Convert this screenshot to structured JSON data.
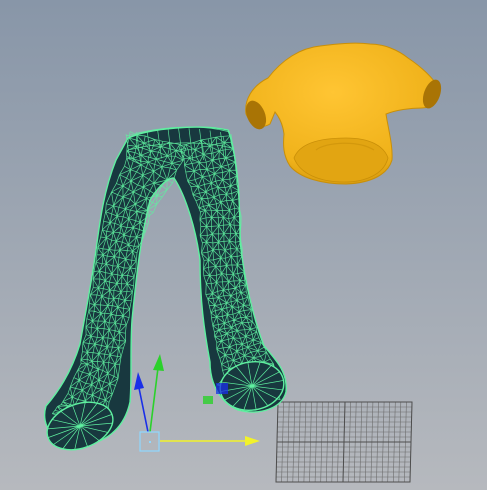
{
  "viewport": {
    "background_top": "#8896a8",
    "background_bottom": "#b6b9be",
    "wireframe_color": "#5ff0a0",
    "wireframe_fill": "#18383f",
    "shirt_color": "#f0b21a",
    "shirt_shadow": "#b98206",
    "grid_color": "#6c6c6c",
    "manipulator": {
      "x_axis_color": "#f2f22a",
      "y_axis_color": "#2bd12b",
      "z_axis_color": "#1a2fe8",
      "center_color": "#8fd8ff"
    }
  },
  "objects": {
    "pants": "wireframe-mesh",
    "shirt": "shaded-mesh",
    "uv_grid": "grid-plane"
  }
}
